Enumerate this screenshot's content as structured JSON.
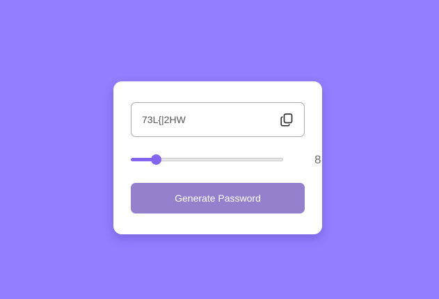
{
  "generator": {
    "password_value": "73L{|2HW",
    "copy_icon": "copy-icon",
    "length": {
      "value": "8",
      "min": 4,
      "max": 32,
      "current": 8
    },
    "generate_label": "Generate Password"
  },
  "colors": {
    "background": "#927eff",
    "card": "#ffffff",
    "accent": "#8465f0",
    "button": "#9480cc"
  }
}
